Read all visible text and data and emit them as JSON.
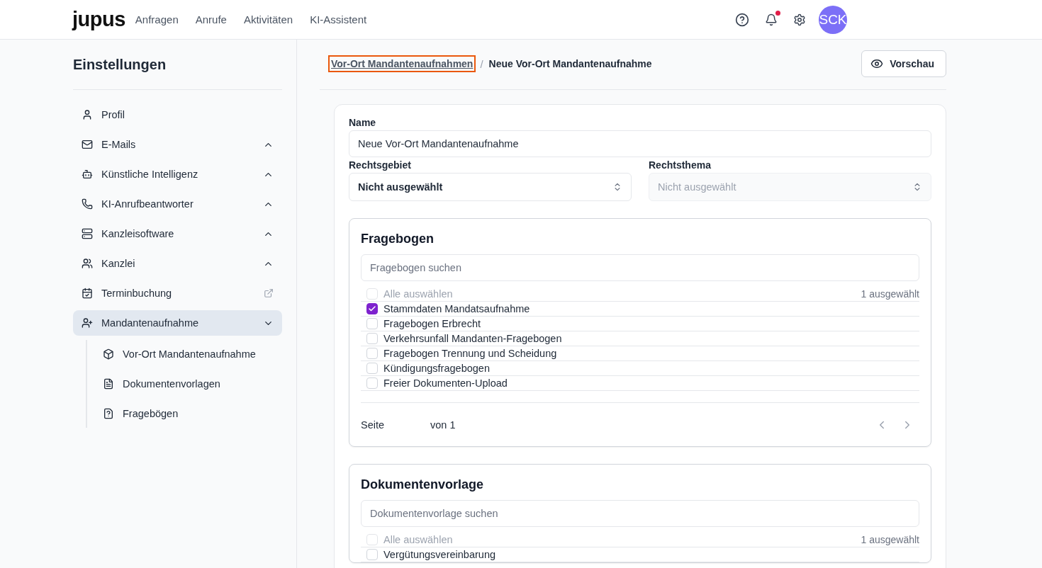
{
  "header": {
    "logo": "jupus",
    "nav": [
      {
        "label": "Anfragen",
        "selected": false
      },
      {
        "label": "Anrufe",
        "selected": false
      },
      {
        "label": "Aktivitäten",
        "selected": false
      },
      {
        "label": "KI-Assistent",
        "selected": false
      }
    ],
    "notification_unread": true,
    "avatar": "SCK"
  },
  "sidebar": {
    "title": "Einstellungen",
    "items": [
      {
        "label": "Profil",
        "kind": "plain",
        "selected": false
      },
      {
        "label": "E-Mails",
        "kind": "group",
        "expanded": false,
        "selected": false
      },
      {
        "label": "Künstliche Intelligenz",
        "kind": "group",
        "expanded": false,
        "selected": false
      },
      {
        "label": "KI-Anrufbeantworter",
        "kind": "group",
        "expanded": false,
        "selected": false
      },
      {
        "label": "Kanzleisoftware",
        "kind": "group",
        "expanded": false,
        "selected": false
      },
      {
        "label": "Kanzlei",
        "kind": "group",
        "expanded": false,
        "selected": false
      },
      {
        "label": "Terminbuchung",
        "kind": "external",
        "selected": false
      },
      {
        "label": "Mandantenaufnahme",
        "kind": "group",
        "expanded": true,
        "selected": true,
        "children": [
          {
            "label": "Vor-Ort Mandantenaufnahme"
          },
          {
            "label": "Dokumentenvorlagen"
          },
          {
            "label": "Fragebögen"
          }
        ]
      }
    ]
  },
  "breadcrumb": {
    "link": {
      "label": "Vor-Ort Mandantenaufnahmen",
      "focused": true
    },
    "separator": "/",
    "current": "Neue Vor-Ort Mandantenaufnahme"
  },
  "preview_button": "Vorschau",
  "form": {
    "name": {
      "label": "Name",
      "value": "Neue Vor-Ort Mandantenaufnahme"
    },
    "selects": [
      {
        "label": "Rechtsgebiet",
        "value": "Nicht ausgewählt",
        "disabled": false
      },
      {
        "label": "Rechtsthema",
        "value": "Nicht ausgewählt",
        "disabled": true
      }
    ],
    "sections": [
      {
        "title": "Fragebogen",
        "search_placeholder": "Fragebogen suchen",
        "select_all": {
          "label": "Alle auswählen",
          "checked": false,
          "disabled": true
        },
        "count": "1 ausgewählt",
        "items": [
          {
            "label": "Stammdaten Mandatsaufnahme",
            "checked": true
          },
          {
            "label": "Fragebogen Erbrecht",
            "checked": false
          },
          {
            "label": "Verkehrsunfall Mandanten-Fragebogen",
            "checked": false
          },
          {
            "label": "Fragebogen Trennung und Scheidung",
            "checked": false
          },
          {
            "label": "Kündigungsfragebogen",
            "checked": false
          },
          {
            "label": "Freier Dokumenten-Upload",
            "checked": false
          }
        ],
        "pagination": {
          "page_label": "Seite",
          "of_label": "von 1"
        }
      },
      {
        "title": "Dokumentenvorlage",
        "search_placeholder": "Dokumentenvorlage suchen",
        "select_all": {
          "label": "Alle auswählen",
          "checked": false,
          "disabled": true
        },
        "count": "1 ausgewählt",
        "items": [
          {
            "label": "Vergütungsvereinbarung",
            "checked": false
          }
        ]
      }
    ]
  }
}
